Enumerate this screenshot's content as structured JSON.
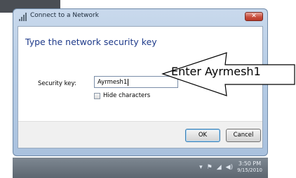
{
  "window": {
    "title": "Connect to a Network",
    "close_glyph": "✕"
  },
  "dialog": {
    "heading": "Type the network security key",
    "security_key_label": "Security key:",
    "security_key_value": "Ayrmesh1",
    "hide_characters_label": "Hide characters",
    "hide_characters_checked": false,
    "ok_label": "OK",
    "cancel_label": "Cancel"
  },
  "annotation": {
    "text": "Enter Ayrmesh1"
  },
  "taskbar": {
    "time": "3:50 PM",
    "date": "9/15/2010",
    "tray_icons": [
      "show-hidden-icon",
      "flag-icon",
      "network-icon",
      "volume-icon"
    ]
  }
}
